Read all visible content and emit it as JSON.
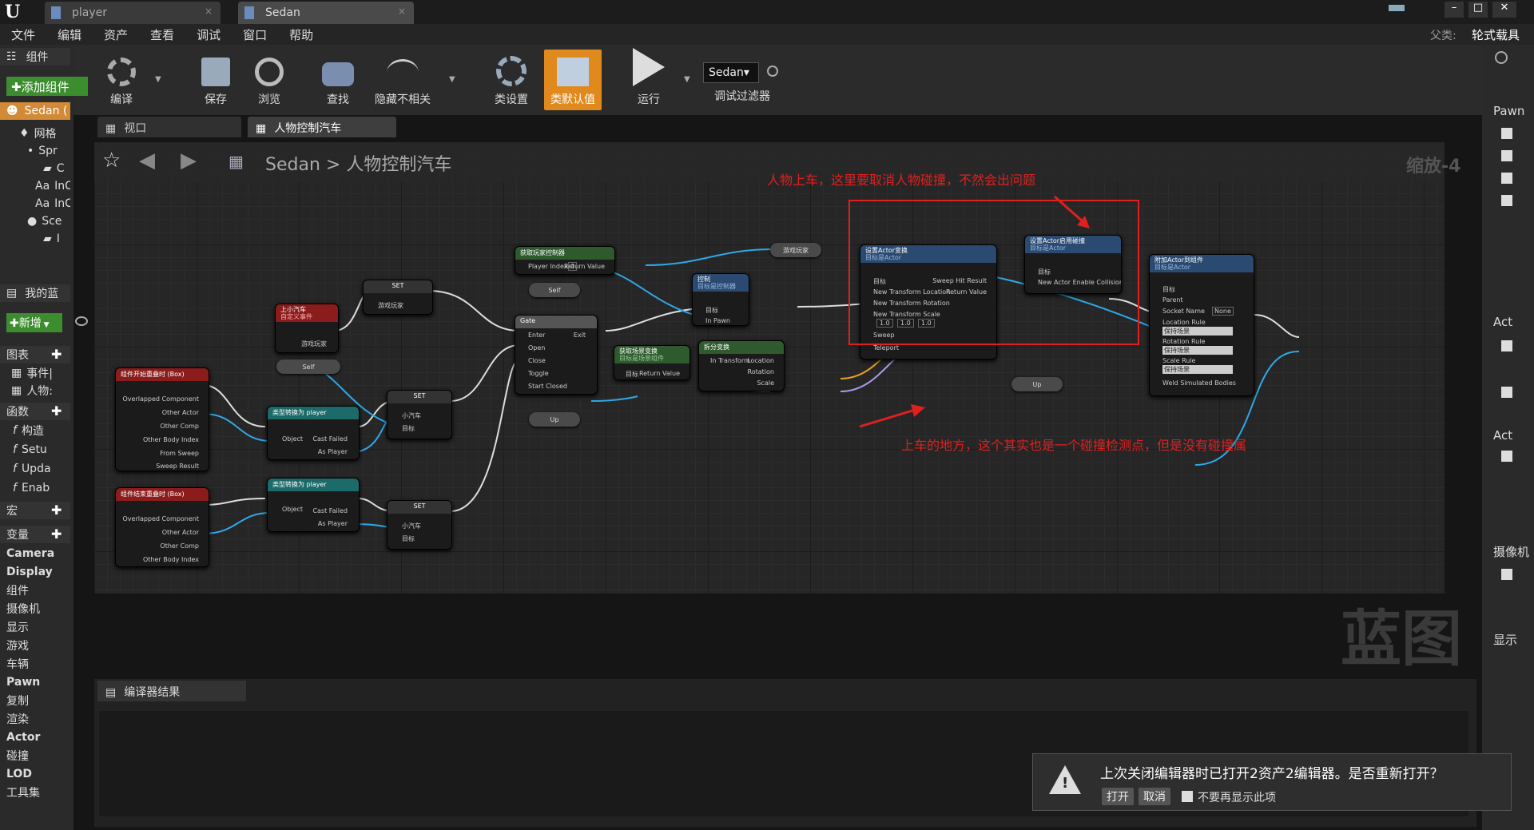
{
  "titlebar": {
    "tabs": [
      {
        "label": "player"
      },
      {
        "label": "Sedan"
      }
    ]
  },
  "menu": [
    "文件",
    "编辑",
    "资产",
    "查看",
    "调试",
    "窗口",
    "帮助"
  ],
  "parent_class": {
    "label": "父类:",
    "value": "轮式载具"
  },
  "toolbar": {
    "compile": "编译",
    "save": "保存",
    "browse": "浏览",
    "find": "查找",
    "hide_unrelated": "隐藏不相关",
    "class_settings": "类设置",
    "class_defaults": "类默认值",
    "play": "运行",
    "debug_object": "Sedan▾",
    "debug_filter": "调试过滤器"
  },
  "left": {
    "components_title": "组件",
    "add_component": "添加组件",
    "root": "Sedan (",
    "tree": [
      "网格",
      "Spr",
      "C",
      "InC",
      "InC",
      "Sce",
      "I"
    ],
    "mybp_title": "我的蓝",
    "add_new": "新增",
    "graphs": "图表",
    "event_graph": "事件|",
    "person": "人物:",
    "functions": "函数",
    "funcs": [
      "构造",
      "Setu",
      "Upda",
      "Enab"
    ],
    "macros": "宏",
    "variables": "变量",
    "var_cats": [
      "Camera",
      "Display",
      "组件",
      "摄像机",
      "显示",
      "游戏",
      "车辆",
      "Pawn",
      "复制",
      "渲染",
      "Actor",
      "碰撞",
      "LOD",
      "工具集"
    ]
  },
  "doc_tabs": {
    "viewport": "视口",
    "graph": "人物控制汽车"
  },
  "breadcrumb": {
    "root": "Sedan",
    "sep": ">",
    "current": "人物控制汽车",
    "zoom": "缩放-4"
  },
  "watermark": "蓝图",
  "annotations": {
    "top": "人物上车，这里要取消人物碰撞，不然会出问题",
    "bottom": "上车的地方，这个其实也是一个碰撞检测点，但是没有碰撞属"
  },
  "nodes": {
    "overlap_begin": {
      "title": "组件开始重叠时 (Box)",
      "pins": [
        "Overlapped Component",
        "Other Actor",
        "Other Comp",
        "Other Body Index",
        "From Sweep",
        "Sweep Result"
      ]
    },
    "overlap_end": {
      "title": "组件结束重叠时 (Box)",
      "pins": [
        "Overlapped Component",
        "Other Actor",
        "Other Comp",
        "Other Body Index"
      ]
    },
    "custom_event": {
      "title": "上小汽车",
      "sub": "自定义事件",
      "pin": "游戏玩家"
    },
    "self1": "Self",
    "cast1": {
      "title": "类型转换为 player",
      "pins": [
        "Object",
        "Cast Failed",
        "As Player"
      ]
    },
    "cast2": {
      "title": "类型转换为 player",
      "pins": [
        "Object",
        "Cast Failed",
        "As Player"
      ]
    },
    "set_top": {
      "title": "SET",
      "pin": "游戏玩家"
    },
    "set_mid": {
      "title": "SET",
      "pins": [
        "小汽车",
        "目标"
      ]
    },
    "set_bot": {
      "title": "SET",
      "pins": [
        "小汽车",
        "目标"
      ]
    },
    "get_pc": {
      "title": "获取玩家控制器",
      "pins": [
        "Player Index",
        "Return Value"
      ],
      "index": "0"
    },
    "self2": "Self",
    "gate": {
      "title": "Gate",
      "pins": [
        "Enter",
        "Exit",
        "Open",
        "Close",
        "Toggle",
        "Start Closed"
      ]
    },
    "up1": "Up",
    "possess": {
      "title": "控制",
      "sub": "目标是控制器",
      "pins": [
        "目标",
        "In Pawn"
      ]
    },
    "get_transform": {
      "title": "获取场景变换",
      "sub": "目标是场景组件",
      "pins": [
        "目标",
        "Return Value"
      ]
    },
    "break_transform": {
      "title": "拆分变换",
      "pins": [
        "In Transform",
        "Location",
        "Rotation",
        "Scale"
      ]
    },
    "player_var": "游戏玩家",
    "set_actor_transform": {
      "title": "设置Actor变换",
      "sub": "目标是Actor",
      "pins": [
        "目标",
        "Sweep Hit Result",
        "New Transform Location",
        "Return Value",
        "New Transform Rotation",
        "New Transform Scale",
        "Sweep",
        "Teleport"
      ],
      "scale": [
        "1.0",
        "1.0",
        "1.0"
      ]
    },
    "set_collision": {
      "title": "设置Actor启用碰撞",
      "sub": "目标是Actor",
      "pins": [
        "目标",
        "New Actor Enable Collision"
      ]
    },
    "attach": {
      "title": "附加Actor到组件",
      "sub": "目标是Actor",
      "pins": [
        "目标",
        "Parent",
        "Socket Name",
        "Location Rule",
        "Rotation Rule",
        "Scale Rule",
        "Weld Simulated Bodies"
      ],
      "socket": "None",
      "rule": "保持场景"
    },
    "up2": "Up"
  },
  "right": {
    "pawn": "Pawn",
    "actor1": "Act",
    "actor2": "Act",
    "camera": "摄像机",
    "display": "显示"
  },
  "bottom": {
    "tab": "编译器结果"
  },
  "dialog": {
    "message": "上次关闭编辑器时已打开2资产2编辑器。是否重新打开？",
    "open": "打开",
    "cancel": "取消",
    "dont_show": "不要再显示此项"
  }
}
